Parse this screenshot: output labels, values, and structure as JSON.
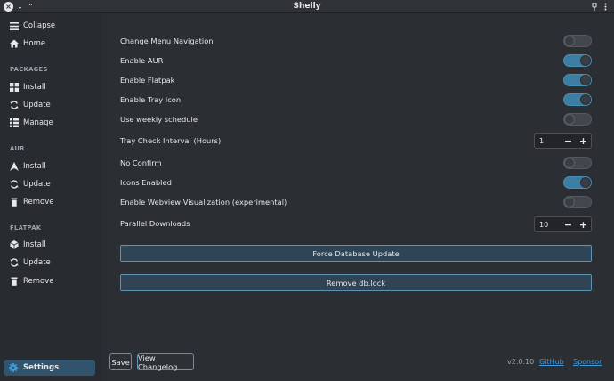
{
  "window": {
    "title": "Shelly"
  },
  "sidebar": {
    "collapse": "Collapse",
    "home": "Home",
    "sections": [
      {
        "title": "PACKAGES",
        "items": [
          "Install",
          "Update",
          "Manage"
        ]
      },
      {
        "title": "AUR",
        "items": [
          "Install",
          "Update",
          "Remove"
        ]
      },
      {
        "title": "FLATPAK",
        "items": [
          "Install",
          "Update",
          "Remove"
        ]
      }
    ],
    "settings": "Settings"
  },
  "settings": {
    "change_menu_navigation": {
      "label": "Change Menu Navigation",
      "on": false
    },
    "enable_aur": {
      "label": "Enable AUR",
      "on": true
    },
    "enable_flatpak": {
      "label": "Enable Flatpak",
      "on": true
    },
    "enable_tray_icon": {
      "label": "Enable Tray Icon",
      "on": true
    },
    "use_weekly_schedule": {
      "label": "Use weekly schedule",
      "on": false
    },
    "tray_check_interval": {
      "label": "Tray Check Interval (Hours)",
      "value": "1"
    },
    "no_confirm": {
      "label": "No Confirm",
      "on": false
    },
    "icons_enabled": {
      "label": "Icons Enabled",
      "on": true
    },
    "webview_visualization": {
      "label": "Enable Webview Visualization (experimental)",
      "on": false
    },
    "parallel_downloads": {
      "label": "Parallel Downloads",
      "value": "10"
    },
    "force_db_update": "Force Database Update",
    "remove_db_lock": "Remove db.lock"
  },
  "footer": {
    "save": "Save",
    "view_changelog": "View Changelog",
    "version": "v2.0.10",
    "github": "GitHub",
    "sponsor": "Sponsor"
  },
  "colors": {
    "accent": "#3c7ea3",
    "link": "#3d9be0",
    "button_border": "#5f93b3"
  }
}
